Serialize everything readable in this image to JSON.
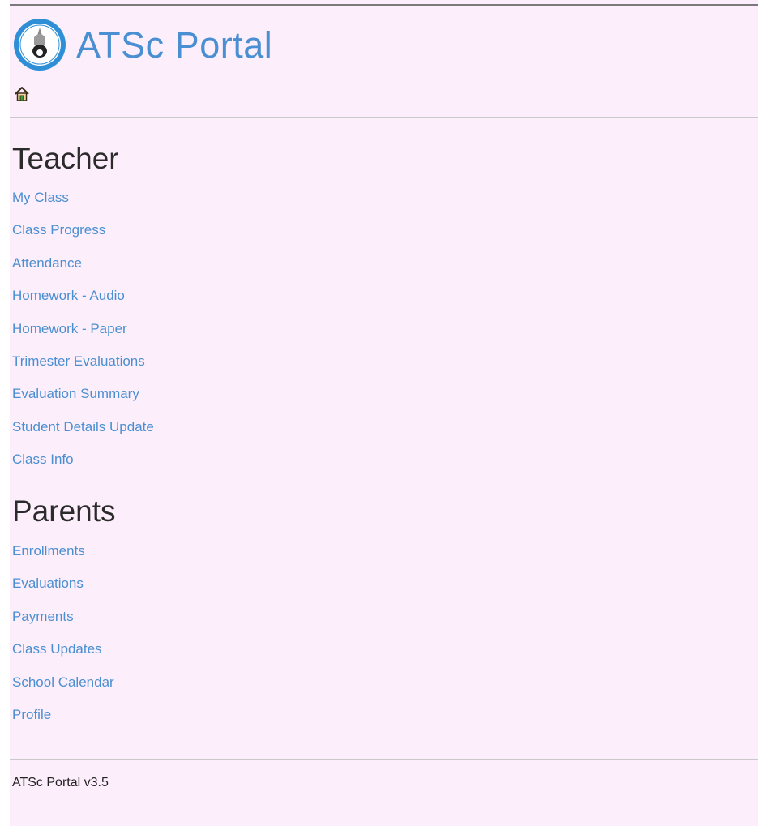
{
  "header": {
    "site_title": "ATSc Portal",
    "logo_icon": "school-crest-logo",
    "home_icon": "home-icon"
  },
  "teacher": {
    "heading": "Teacher",
    "links": [
      "My Class",
      "Class Progress",
      "Attendance",
      "Homework - Audio",
      "Homework - Paper",
      "Trimester Evaluations",
      "Evaluation Summary",
      "Student Details Update",
      "Class Info"
    ]
  },
  "parents": {
    "heading": "Parents",
    "links": [
      "Enrollments",
      "Evaluations",
      "Payments",
      "Class Updates",
      "School Calendar",
      "Profile"
    ]
  },
  "footer": {
    "version_text": "ATSc Portal v3.5"
  },
  "colors": {
    "background": "#fdeefc",
    "link": "#4a8fd1",
    "title": "#4a8fd1",
    "heading": "#2b2b2b"
  }
}
